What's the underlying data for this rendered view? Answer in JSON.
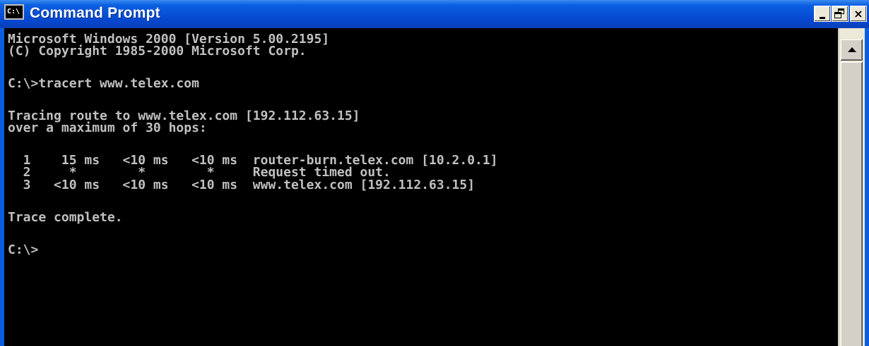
{
  "window": {
    "title": "Command Prompt",
    "icon_text": "C:\\"
  },
  "controls": {
    "minimize_icon": "minimize-icon",
    "maximize_icon": "restore-icon",
    "close_label": "×"
  },
  "console": {
    "lines": [
      "Microsoft Windows 2000 [Version 5.00.2195]",
      "(C) Copyright 1985-2000 Microsoft Corp.",
      "",
      "C:\\>tracert www.telex.com",
      "",
      "Tracing route to www.telex.com [192.112.63.15]",
      "over a maximum of 30 hops:",
      "",
      "  1    15 ms   <10 ms   <10 ms  router-burn.telex.com [10.2.0.1]",
      "  2     *        *        *     Request timed out.",
      "  3   <10 ms   <10 ms   <10 ms  www.telex.com [192.112.63.15]",
      "",
      "Trace complete.",
      "",
      "C:\\>"
    ]
  },
  "colors": {
    "title_bar": "#0548d0",
    "console_bg": "#000000",
    "console_text": "#c0c0c0"
  }
}
